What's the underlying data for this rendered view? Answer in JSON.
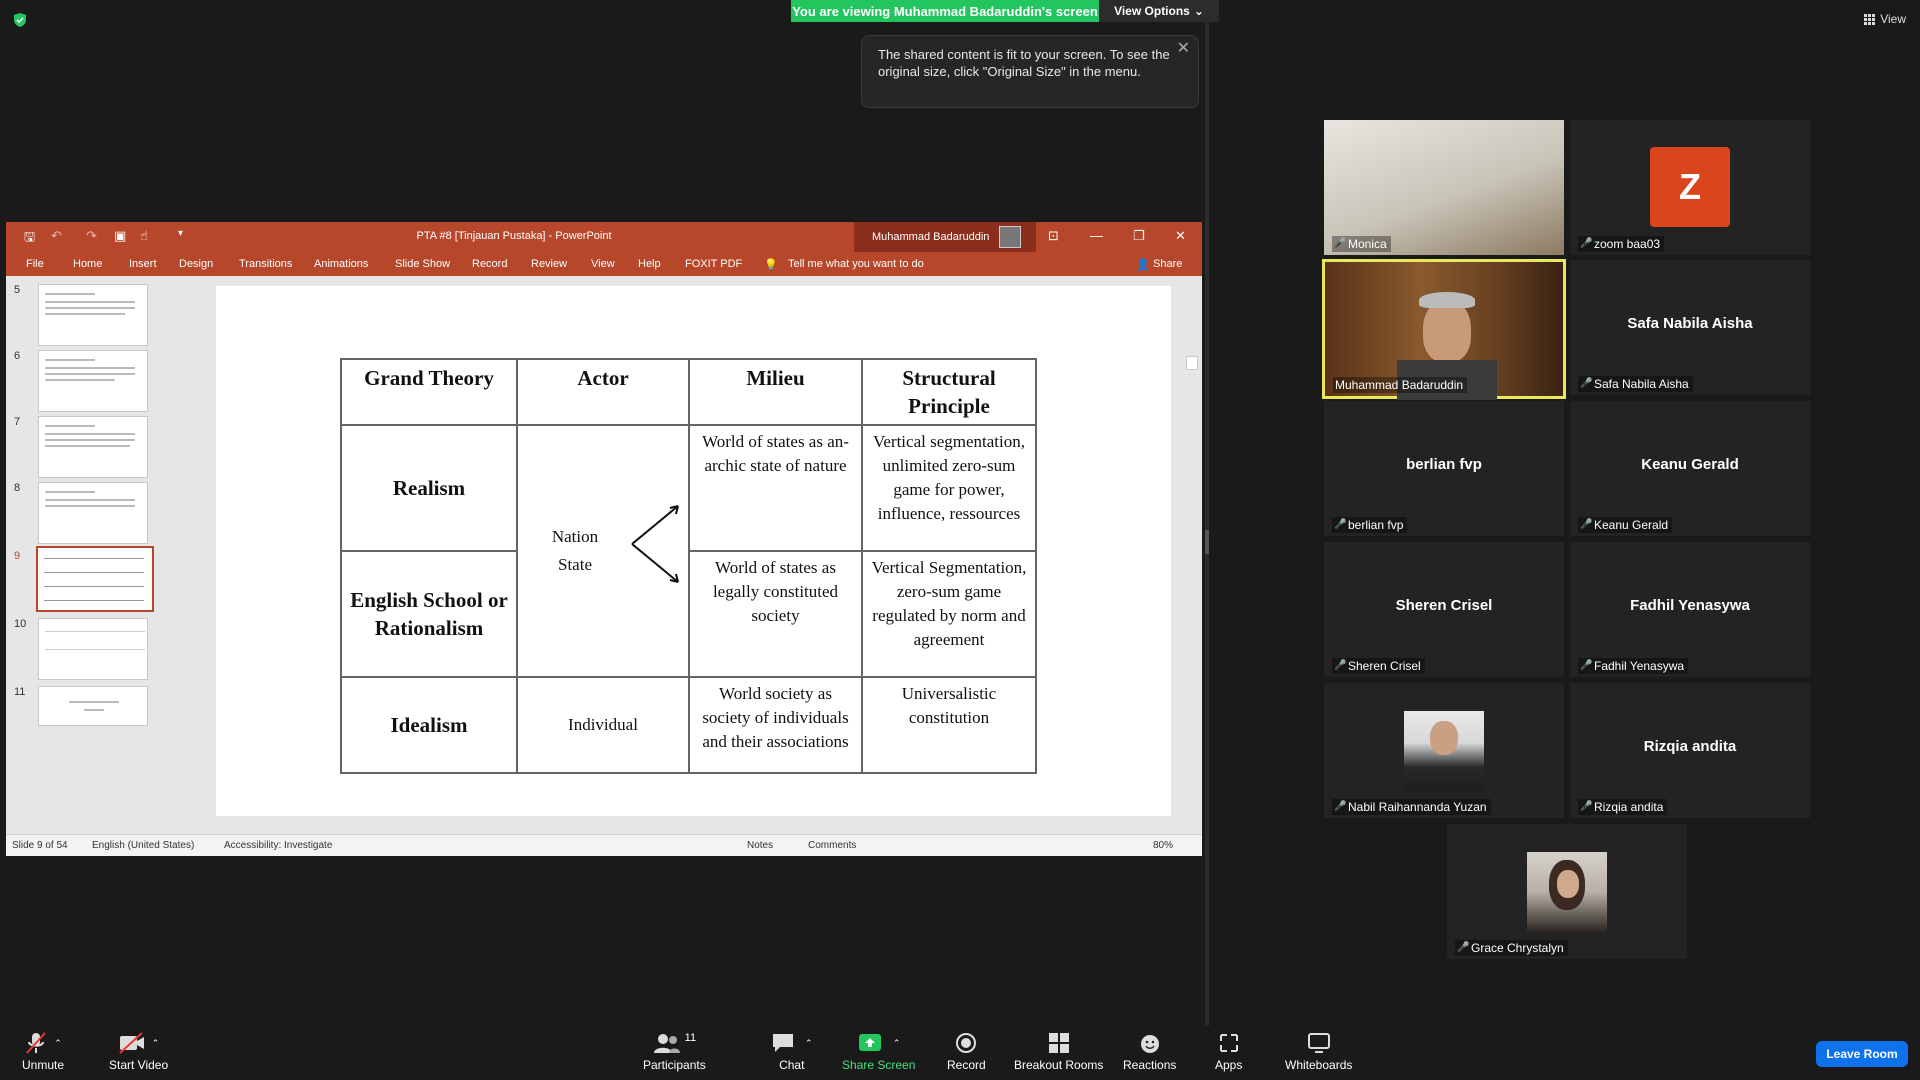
{
  "banner": {
    "viewing_text": "You are viewing Muhammad Badaruddin's screen",
    "view_options": "View Options",
    "tooltip_text": "The shared content is fit to your screen. To see the original size, click \"Original Size\" in the menu.",
    "view_label": "View"
  },
  "ppt": {
    "doc_title": "PTA #8 [Tinjauan Pustaka]  -  PowerPoint",
    "user": "Muhammad Badaruddin",
    "tabs": [
      "File",
      "Home",
      "Insert",
      "Design",
      "Transitions",
      "Animations",
      "Slide Show",
      "Record",
      "Review",
      "View",
      "Help",
      "FOXIT PDF"
    ],
    "tell_me": "Tell me what you want to do",
    "share": "Share",
    "thumbnail_numbers": [
      "5",
      "6",
      "7",
      "8",
      "9",
      "10",
      "11"
    ],
    "status": {
      "slide": "Slide 9 of 54",
      "language": "English (United States)",
      "accessibility": "Accessibility: Investigate",
      "notes": "Notes",
      "comments": "Comments",
      "zoom": "80%"
    }
  },
  "slide_table": {
    "headers": [
      "Grand Theory",
      "Actor",
      "Milieu",
      "Structural Principle"
    ],
    "row1": {
      "theory": "Realism",
      "milieu": "World of states as an-archic state of nature",
      "principle": "Vertical segmentation, unlimited zero-sum game for power, influence, ressources"
    },
    "actor_shared": "Nation State",
    "row2": {
      "theory": "English School or Rationalism",
      "milieu": "World of states as legally constituted society",
      "principle": "Vertical Segmentation, zero-sum game regulated by norm and agreement"
    },
    "row3": {
      "theory": "Idealism",
      "actor": "Individual",
      "milieu": "World society as society of individuals and their associations",
      "principle": "Universalistic constitution"
    }
  },
  "participants": [
    {
      "name": "Monica",
      "video": true
    },
    {
      "name": "zoom baa03",
      "avatar_letter": "Z",
      "avatar_color": "#d9461e"
    },
    {
      "name": "Muhammad Badaruddin",
      "video": true,
      "active": true
    },
    {
      "name": "Safa Nabila Aisha"
    },
    {
      "name": "berlian fvp"
    },
    {
      "name": "Keanu Gerald"
    },
    {
      "name": "Sheren Crisel"
    },
    {
      "name": "Fadhil Yenasywa"
    },
    {
      "name": "Nabil Raihannanda Yuzan",
      "photo": true
    },
    {
      "name": "Rizqia andita"
    },
    {
      "name": "Grace Chrystalyn",
      "photo": true
    }
  ],
  "toolbar": {
    "unmute": "Unmute",
    "start_video": "Start Video",
    "participants": "Participants",
    "participants_count": "11",
    "chat": "Chat",
    "share_screen": "Share Screen",
    "record": "Record",
    "breakout_rooms": "Breakout Rooms",
    "reactions": "Reactions",
    "apps": "Apps",
    "whiteboards": "Whiteboards",
    "leave_room": "Leave Room"
  },
  "colors": {
    "ppt_brand": "#b7472a",
    "banner_green": "#22c55e",
    "leave_blue": "#0e72ed",
    "active_border": "#e8e85a"
  }
}
